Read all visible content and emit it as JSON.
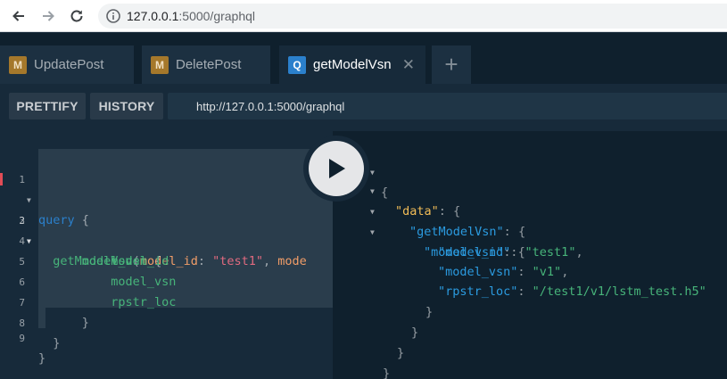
{
  "browser": {
    "url_host": "127.0.0.1",
    "url_rest": ":5000/graphql",
    "back_icon": "arrow-left-icon",
    "forward_icon": "arrow-right-icon",
    "reload_icon": "reload-icon"
  },
  "tabs": [
    {
      "badge": "M",
      "label": "UpdatePost"
    },
    {
      "badge": "M",
      "label": "DeletePost"
    },
    {
      "badge": "Q",
      "label": "getModelVsn",
      "close": "✕"
    }
  ],
  "add_tab": "+",
  "toolbar": {
    "prettify": "PRETTIFY",
    "history": "HISTORY",
    "endpoint": "http://127.0.0.1:5000/graphql"
  },
  "editor": {
    "line_numbers": [
      "1",
      "2",
      "3",
      "4",
      "5",
      "6",
      "7",
      "8",
      "9"
    ],
    "lines": {
      "l1_kw": "query",
      "l1_brace": " {",
      "l2_fn": "getModelVsn",
      "l2_open": "(",
      "l2_attr": "model_id",
      "l2_colon": ": ",
      "l2_str": "\"test1\"",
      "l2_comma": ", ",
      "l2_attr2": "mode",
      "l3_field": "model_vsn",
      "l3_brace": " {",
      "l4": "model_id",
      "l5": "model_vsn",
      "l6": "rpstr_loc",
      "l7": "}",
      "l8": "}",
      "l9": "}"
    }
  },
  "result": {
    "open": "{",
    "data_key": "\"data\"",
    "get_key": "\"getModelVsn\"",
    "vsn_key": "\"model_vsn\"",
    "model_id_key": "\"model_id\"",
    "model_id_val": "\"test1\"",
    "model_vsn_key": "\"model_vsn\"",
    "model_vsn_val": "\"v1\"",
    "rpstr_key": "\"rpstr_loc\"",
    "rpstr_val": "\"/test1/v1/lstm_test.h5\"",
    "colon": ": ",
    "brace_open": "{",
    "brace_close": "}",
    "comma": ","
  }
}
